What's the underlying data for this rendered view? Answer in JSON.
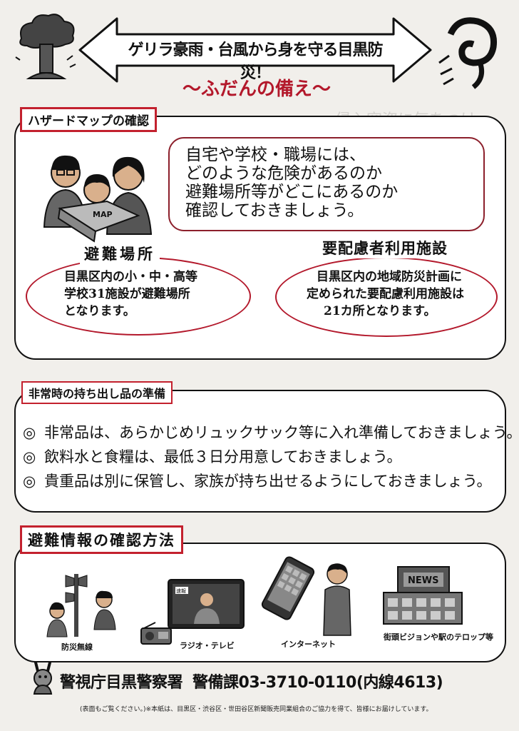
{
  "header": {
    "title": "ゲリラ豪雨・台風から身を守る目黒防災！",
    "subtitle": "～ふだんの備え～"
  },
  "hazard": {
    "label": "ハザードマップの確認",
    "message_lines": [
      "自宅や学校・職場には、",
      "どのような危険があるのか",
      "避難場所等がどこにあるのか",
      "確認しておきましょう。"
    ],
    "shelter": {
      "title": "避難場所",
      "lines": [
        "目黒区内の小・中・高等",
        "学校31施設が避難場所",
        "となります。"
      ]
    },
    "care_facility": {
      "title": "要配慮者利用施設",
      "lines": [
        "目黒区内の地域防災計画に",
        "定められた要配慮利用施設は",
        "21カ所となります。"
      ]
    },
    "map_word": "MAP"
  },
  "emergency": {
    "label": "非常時の持ち出し品の準備",
    "mark": "◎",
    "items": [
      "非常品は、あらかじめリュックサック等に入れ準備しておきましょう。",
      "飲料水と食糧は、最低３日分用意しておきましょう。",
      "貴重品は別に保管し、家族が持ち出せるようにしておきましょう。"
    ]
  },
  "info": {
    "label": "避難情報の確認方法",
    "captions": {
      "wireless": "防災無線",
      "radio_tv": "ラジオ・テレビ",
      "internet": "インターネット",
      "street": "街頭ビジョンや駅のテロップ等"
    },
    "tv_badge": "速報",
    "news_sign": "NEWS"
  },
  "footer": {
    "station": "警視庁目黒警察署",
    "department": "警備課03-3710-0110(内線4613)",
    "note": "(表面もご覧ください。)※本紙は、目黒区・渋谷区・世田谷区新聞販売同業組合のご協力を得て、皆様にお届けしています。"
  },
  "colors": {
    "accent": "#c3212e",
    "ellipse": "#b3182b",
    "line": "#111111"
  }
}
